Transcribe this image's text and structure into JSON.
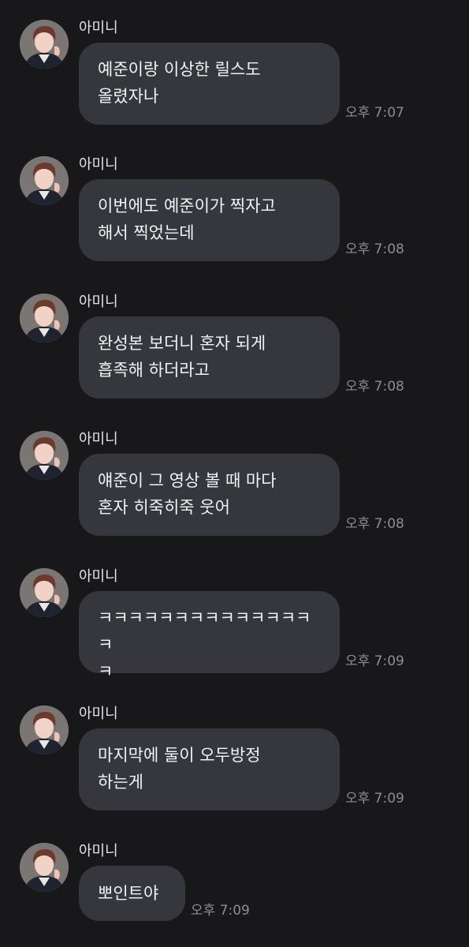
{
  "colors": {
    "background": "#18181b",
    "bubble": "#35373d",
    "text": "#f2f2f2",
    "time": "#8d8d92"
  },
  "messages": [
    {
      "sender": "아미니",
      "avatar_icon": "profile-photo-avatar",
      "text": "예준이랑 이상한 릴스도\n올렸자나",
      "time": "오후 7:07"
    },
    {
      "sender": "아미니",
      "avatar_icon": "profile-photo-avatar",
      "text": "이번에도 예준이가 찍자고\n해서 찍었는데",
      "time": "오후 7:08"
    },
    {
      "sender": "아미니",
      "avatar_icon": "profile-photo-avatar",
      "text": "완성본 보더니 혼자 되게\n흡족해 하더라고",
      "time": "오후 7:08"
    },
    {
      "sender": "아미니",
      "avatar_icon": "profile-photo-avatar",
      "text": "얘준이 그 영상 볼 때 마다\n혼자 히죽히죽 웃어",
      "time": "오후 7:08"
    },
    {
      "sender": "아미니",
      "avatar_icon": "profile-photo-avatar",
      "text": "ㅋㅋㅋㅋㅋㅋㅋㅋㅋㅋㅋㅋㅋㅋㅋ\nㅋ",
      "time": "오후 7:09"
    },
    {
      "sender": "아미니",
      "avatar_icon": "profile-photo-avatar",
      "text": "마지막에 둘이 오두방정\n하는게",
      "time": "오후 7:09"
    },
    {
      "sender": "아미니",
      "avatar_icon": "profile-photo-avatar",
      "text": "뽀인트야",
      "time": "오후 7:09"
    }
  ]
}
